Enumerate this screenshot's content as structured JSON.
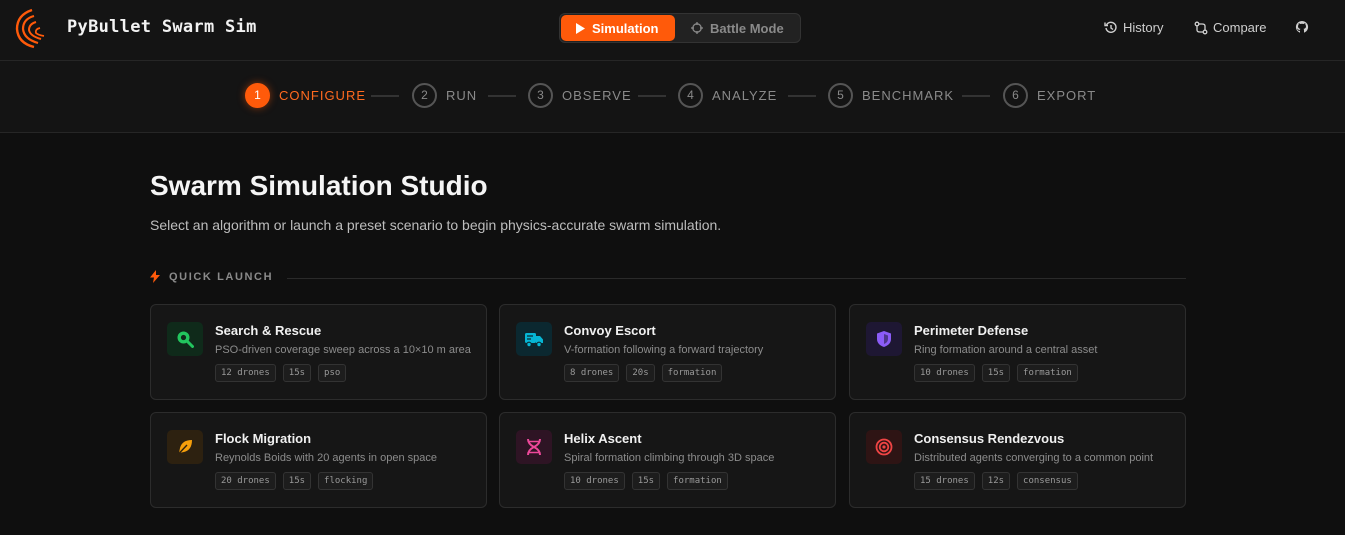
{
  "app": {
    "title": "PyBullet Swarm Sim",
    "brand_color": "#ff5a0a"
  },
  "mode_switch": {
    "simulation": "Simulation",
    "battle": "Battle Mode"
  },
  "nav": {
    "history": "History",
    "compare": "Compare",
    "github": "github-icon"
  },
  "steps": [
    {
      "num": "1",
      "label": "CONFIGURE",
      "active": true
    },
    {
      "num": "2",
      "label": "RUN",
      "active": false
    },
    {
      "num": "3",
      "label": "OBSERVE",
      "active": false
    },
    {
      "num": "4",
      "label": "ANALYZE",
      "active": false
    },
    {
      "num": "5",
      "label": "BENCHMARK",
      "active": false
    },
    {
      "num": "6",
      "label": "EXPORT",
      "active": false
    }
  ],
  "main": {
    "title": "Swarm Simulation Studio",
    "subtitle": "Select an algorithm or launch a preset scenario to begin physics-accurate swarm simulation.",
    "section": "QUICK LAUNCH"
  },
  "cards": [
    {
      "title": "Search & Rescue",
      "desc": "PSO-driven coverage sweep across a 10×10 m area",
      "tags": [
        "12 drones",
        "15s",
        "pso"
      ],
      "icon": "search-icon",
      "color": "#22c55e"
    },
    {
      "title": "Convoy Escort",
      "desc": "V-formation following a forward trajectory",
      "tags": [
        "8 drones",
        "20s",
        "formation"
      ],
      "icon": "truck-icon",
      "color": "#06b6d4"
    },
    {
      "title": "Perimeter Defense",
      "desc": "Ring formation around a central asset",
      "tags": [
        "10 drones",
        "15s",
        "formation"
      ],
      "icon": "shield-icon",
      "color": "#8b5cf6"
    },
    {
      "title": "Flock Migration",
      "desc": "Reynolds Boids with 20 agents in open space",
      "tags": [
        "20 drones",
        "15s",
        "flocking"
      ],
      "icon": "feather-icon",
      "color": "#f59e0b"
    },
    {
      "title": "Helix Ascent",
      "desc": "Spiral formation climbing through 3D space",
      "tags": [
        "10 drones",
        "15s",
        "formation"
      ],
      "icon": "dna-icon",
      "color": "#ec4899"
    },
    {
      "title": "Consensus Rendezvous",
      "desc": "Distributed agents converging to a common point",
      "tags": [
        "15 drones",
        "12s",
        "consensus"
      ],
      "icon": "target-icon",
      "color": "#ef4444"
    }
  ]
}
